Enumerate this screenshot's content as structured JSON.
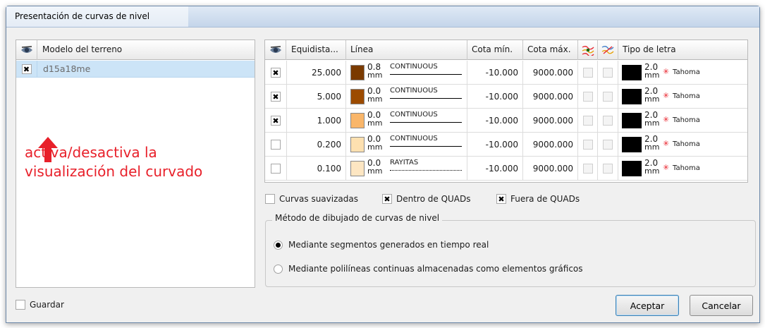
{
  "window": {
    "title": "Presentación de curvas de nivel"
  },
  "models": {
    "header": "Modelo del terreno",
    "rows": [
      {
        "checked": true,
        "name": "d15a18me"
      }
    ]
  },
  "annotation": {
    "line1": "activa/desactiva la",
    "line2": "visualización del curvado"
  },
  "levels": {
    "headers": {
      "equidistance": "Equidista...",
      "line": "Línea",
      "min": "Cota mín.",
      "max": "Cota máx.",
      "font": "Tipo de letra"
    },
    "rows": [
      {
        "checked": true,
        "equidistance": "25.000",
        "color": "#7a3a00",
        "line_width": "0.8",
        "unit": "mm",
        "line_type": "CONTINUOUS",
        "min": "-10.000",
        "max": "9000.000",
        "font_size": "2.0",
        "font_unit": "mm",
        "font_name": "Tahoma"
      },
      {
        "checked": true,
        "equidistance": "5.000",
        "color": "#9c4b00",
        "line_width": "0.0",
        "unit": "mm",
        "line_type": "CONTINUOUS",
        "min": "-10.000",
        "max": "9000.000",
        "font_size": "2.0",
        "font_unit": "mm",
        "font_name": "Tahoma"
      },
      {
        "checked": true,
        "equidistance": "1.000",
        "color": "#f9b66a",
        "line_width": "0.0",
        "unit": "mm",
        "line_type": "CONTINUOUS",
        "min": "-10.000",
        "max": "9000.000",
        "font_size": "2.0",
        "font_unit": "mm",
        "font_name": "Tahoma"
      },
      {
        "checked": false,
        "equidistance": "0.200",
        "color": "#fde0b0",
        "line_width": "0.0",
        "unit": "mm",
        "line_type": "CONTINUOUS",
        "min": "-10.000",
        "max": "9000.000",
        "font_size": "2.0",
        "font_unit": "mm",
        "font_name": "Tahoma"
      },
      {
        "checked": false,
        "equidistance": "0.100",
        "color": "#fde6c2",
        "line_width": "0.0",
        "unit": "mm",
        "line_type": "RAYITAS",
        "min": "-10.000",
        "max": "9000.000",
        "font_size": "2.0",
        "font_unit": "mm",
        "font_name": "Tahoma"
      }
    ]
  },
  "options": {
    "smooth": {
      "label": "Curvas suavizadas",
      "checked": false
    },
    "inside": {
      "label": "Dentro de QUADs",
      "checked": true
    },
    "outside": {
      "label": "Fuera de QUADs",
      "checked": true
    }
  },
  "method": {
    "title": "Método de dibujado de curvas de nivel",
    "option1": "Mediante segmentos generados en tiempo real",
    "option2": "Mediante polilíneas continuas almacenadas como elementos gráficos",
    "selected": 1
  },
  "footer": {
    "save_label": "Guardar",
    "accept_label": "Aceptar",
    "cancel_label": "Cancelar"
  },
  "colors": {
    "annotation": "#e8202a",
    "selection": "#cce4f7"
  }
}
